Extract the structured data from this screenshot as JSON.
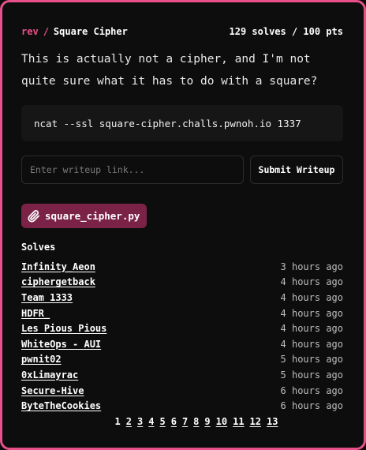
{
  "challenge": {
    "category": "rev",
    "separator": "/",
    "title": "Square Cipher",
    "stats": "129 solves / 100 pts",
    "description": "This is actually not a cipher, and I'm not quite sure what it has to do with a square?",
    "command": "ncat --ssl square-cipher.challs.pwnoh.io 1337"
  },
  "writeup": {
    "placeholder": "Enter writeup link...",
    "value": "",
    "submit_label": "Submit Writeup"
  },
  "files": [
    {
      "name": "square_cipher.py",
      "icon": "paperclip-icon"
    }
  ],
  "solves": {
    "heading": "Solves",
    "items": [
      {
        "name": "Infinity_Aeon",
        "time": "3 hours ago"
      },
      {
        "name": "ciphergetback",
        "time": "4 hours ago"
      },
      {
        "name": "Team 1333",
        "time": "4 hours ago"
      },
      {
        "name": "HDFR_",
        "time": "4 hours ago"
      },
      {
        "name": "Les Pious Pious",
        "time": "4 hours ago"
      },
      {
        "name": "WhiteOps - AUI",
        "time": "4 hours ago"
      },
      {
        "name": "pwnit02",
        "time": "5 hours ago"
      },
      {
        "name": "0xLimayrac",
        "time": "5 hours ago"
      },
      {
        "name": "Secure-Hive",
        "time": "6 hours ago"
      },
      {
        "name": "ByteTheCookies",
        "time": "6 hours ago"
      }
    ]
  },
  "pagination": {
    "current": "1",
    "pages": [
      "1",
      "2",
      "3",
      "4",
      "5",
      "6",
      "7",
      "8",
      "9",
      "10",
      "11",
      "12",
      "13"
    ]
  },
  "colors": {
    "accent": "#e8508a",
    "chip": "#7a2347",
    "background": "#0d0d0e"
  }
}
